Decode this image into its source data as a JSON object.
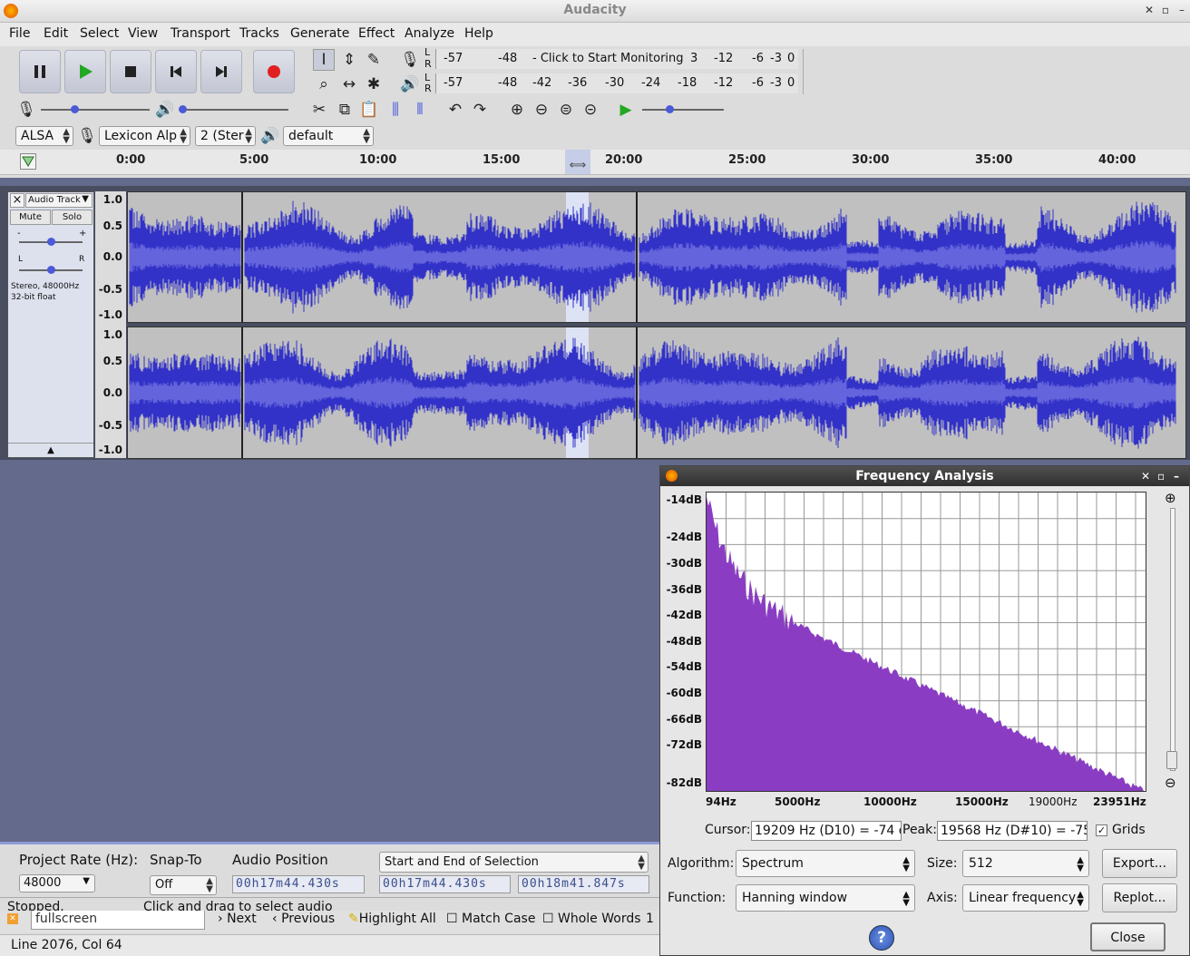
{
  "app": {
    "title": "Audacity"
  },
  "menu": [
    "File",
    "Edit",
    "Select",
    "View",
    "Transport",
    "Tracks",
    "Generate",
    "Effect",
    "Analyze",
    "Help"
  ],
  "meters": {
    "record_scale": [
      "-57",
      "-48",
      "- Click to Start Monitoring",
      "3",
      "-12",
      "-6",
      "-3",
      "0"
    ],
    "play_scale": [
      "-57",
      "-48",
      "-42",
      "-36",
      "-30",
      "-24",
      "-18",
      "-12",
      "-6",
      "-3",
      "0"
    ],
    "channel_letters": [
      "L",
      "R"
    ]
  },
  "device": {
    "host": "ALSA",
    "input": "Lexicon Alp",
    "channels": "2 (Ster",
    "output": "default"
  },
  "ruler": {
    "ticks": [
      "0:00",
      "5:00",
      "10:00",
      "15:00",
      "20:00",
      "25:00",
      "30:00",
      "35:00",
      "40:00"
    ]
  },
  "track": {
    "name": "Audio Track",
    "close": "×",
    "mute": "Mute",
    "solo": "Solo",
    "pan_l": "L",
    "pan_r": "R",
    "info1": "Stereo, 48000Hz",
    "info2": "32-bit float",
    "scale": [
      "1.0",
      "0.5",
      "0.0",
      "-0.5",
      "-1.0"
    ]
  },
  "selection_bar": {
    "project_rate_label": "Project Rate (Hz):",
    "project_rate": "48000",
    "snap_label": "Snap-To",
    "snap_value": "Off",
    "audio_position_label": "Audio Position",
    "selection_mode": "Start and End of Selection",
    "audio_position": "00h17m44.430s",
    "sel_start": "00h17m44.430s",
    "sel_end": "00h18m41.847s"
  },
  "status": {
    "state": "Stopped.",
    "hint": "Click and drag to select audio"
  },
  "findbar": {
    "query": "fullscreen",
    "next": "Next",
    "previous": "Previous",
    "highlight_all": "Highlight All",
    "match_case": "Match Case",
    "whole_words": "Whole Words",
    "count": "1"
  },
  "editor_status": "Line 2076, Col 64",
  "freq_analysis": {
    "title": "Frequency Analysis",
    "db_labels": [
      "-14dB",
      "-24dB",
      "-30dB",
      "-36dB",
      "-42dB",
      "-48dB",
      "-54dB",
      "-60dB",
      "-66dB",
      "-72dB",
      "-82dB"
    ],
    "hz_labels": [
      "94Hz",
      "5000Hz",
      "10000Hz",
      "15000Hz",
      "19000Hz",
      "23951Hz"
    ],
    "cursor_label": "Cursor:",
    "cursor_value": "19209 Hz (D10) = -74 d",
    "peak_label": "Peak:",
    "peak_value": "19568 Hz (D#10) = -75",
    "grids_label": "Grids",
    "grids_checked": true,
    "algorithm_label": "Algorithm:",
    "algorithm": "Spectrum",
    "size_label": "Size:",
    "size": "512",
    "function_label": "Function:",
    "function": "Hanning window",
    "axis_label": "Axis:",
    "axis": "Linear frequency",
    "export": "Export...",
    "replot": "Replot...",
    "close": "Close",
    "help": "?"
  },
  "colors": {
    "waveform": "#3232c8",
    "waveform_rms": "#6464dc",
    "spectrum": "#8a3dc2",
    "selection": "#8c9bd9",
    "record": "#e02020",
    "play": "#20a020"
  }
}
